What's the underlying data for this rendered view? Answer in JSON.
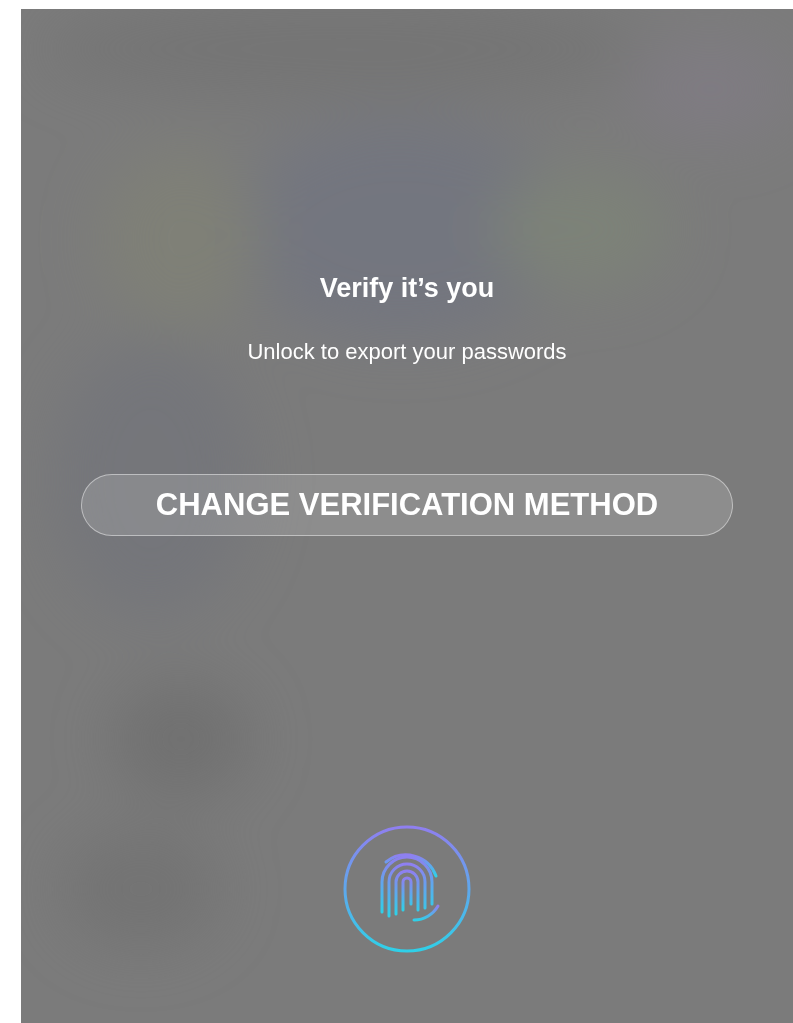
{
  "title": "Verify it’s you",
  "subtitle": "Unlock to export your passwords",
  "button": {
    "label": "CHANGE VERIFICATION METHOD"
  }
}
